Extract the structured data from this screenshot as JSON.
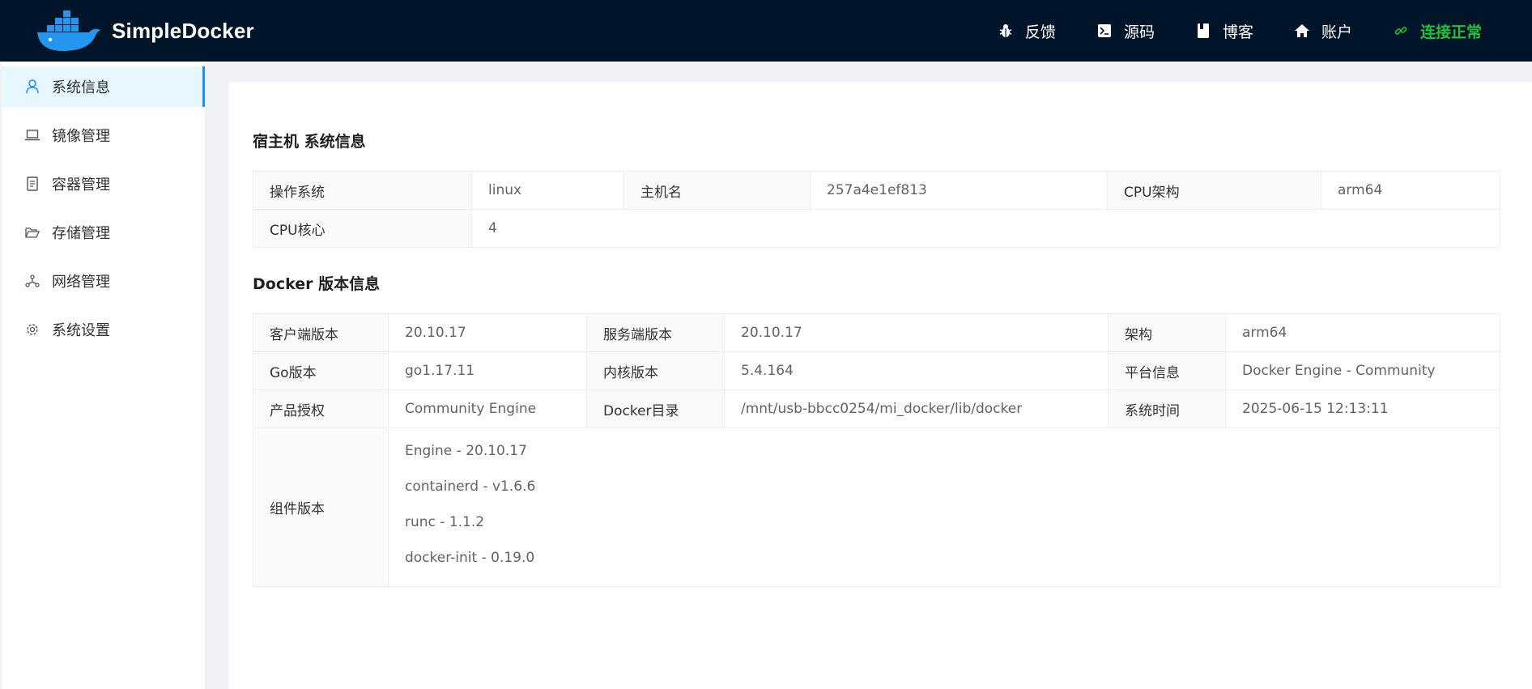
{
  "header": {
    "logo_text": "SimpleDocker",
    "nav": [
      {
        "label": "反馈",
        "icon": "bug-icon"
      },
      {
        "label": "源码",
        "icon": "terminal-icon"
      },
      {
        "label": "博客",
        "icon": "book-icon"
      },
      {
        "label": "账户",
        "icon": "home-icon"
      },
      {
        "label": "连接正常",
        "icon": "link-icon"
      }
    ],
    "status_color": "#1fc23a"
  },
  "sidebar": {
    "items": [
      {
        "label": "系统信息",
        "icon": "user-icon",
        "active": true
      },
      {
        "label": "镜像管理",
        "icon": "laptop-icon"
      },
      {
        "label": "容器管理",
        "icon": "container-icon"
      },
      {
        "label": "存储管理",
        "icon": "folder-open-icon"
      },
      {
        "label": "网络管理",
        "icon": "network-icon"
      },
      {
        "label": "系统设置",
        "icon": "gear-icon"
      }
    ]
  },
  "host": {
    "title": "宿主机 系统信息",
    "os_label": "操作系统",
    "os_value": "linux",
    "hostname_label": "主机名",
    "hostname_value": "257a4e1ef813",
    "arch_label": "CPU架构",
    "arch_value": "arm64",
    "cpu_label": "CPU核心",
    "cpu_value": "4"
  },
  "docker": {
    "title": "Docker 版本信息",
    "client_label": "客户端版本",
    "client_value": "20.10.17",
    "server_label": "服务端版本",
    "server_value": "20.10.17",
    "arch_label": "架构",
    "arch_value": "arm64",
    "go_label": "Go版本",
    "go_value": "go1.17.11",
    "kernel_label": "内核版本",
    "kernel_value": "5.4.164",
    "platform_label": "平台信息",
    "platform_value": "Docker Engine - Community",
    "license_label": "产品授权",
    "license_value": "Community Engine",
    "dir_label": "Docker目录",
    "dir_value": "/mnt/usb-bbcc0254/mi_docker/lib/docker",
    "time_label": "系统时间",
    "time_value": "2025-06-15 12:13:11",
    "components_label": "组件版本",
    "components": [
      "Engine - 20.10.17",
      "containerd - v1.6.6",
      "runc - 1.1.2",
      "docker-init - 0.19.0"
    ]
  }
}
